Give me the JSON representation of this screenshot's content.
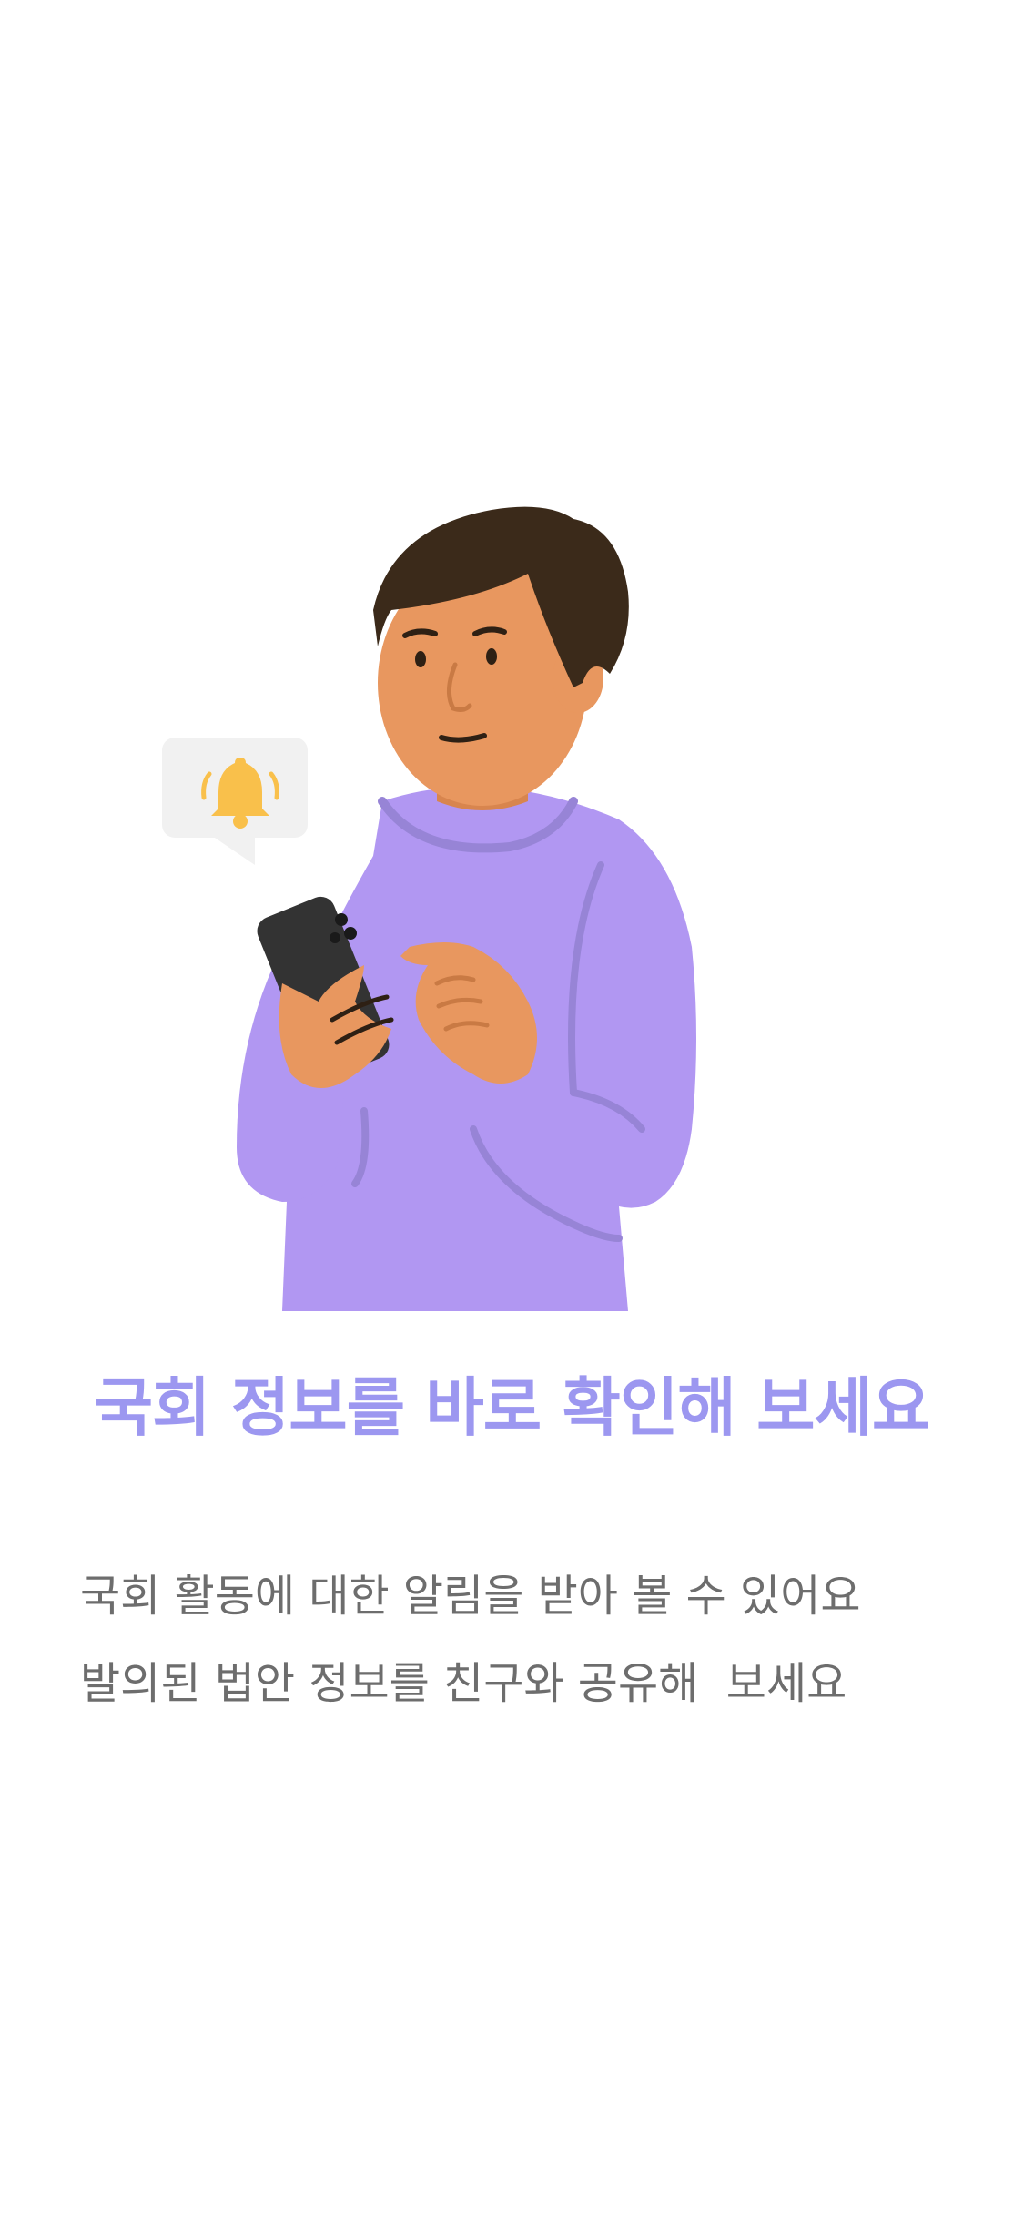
{
  "onboarding": {
    "headline": "국회 정보를 바로 확인해 보세요",
    "description_lines": [
      "국회 활동에 대한 알림을 받아 볼 수 있어요",
      "발의된 법안 정보를 친구와 공유해  보세요"
    ],
    "illustration": {
      "subject": "person-holding-phone",
      "badge_icon": "bell-icon"
    }
  },
  "colors": {
    "headline": "#9c97f0",
    "body_text": "#6d6d6d",
    "sweater": "#b197f2",
    "skin": "#e8975f",
    "hair": "#3b2a1a",
    "bell": "#f9c04b",
    "phone": "#333333"
  }
}
